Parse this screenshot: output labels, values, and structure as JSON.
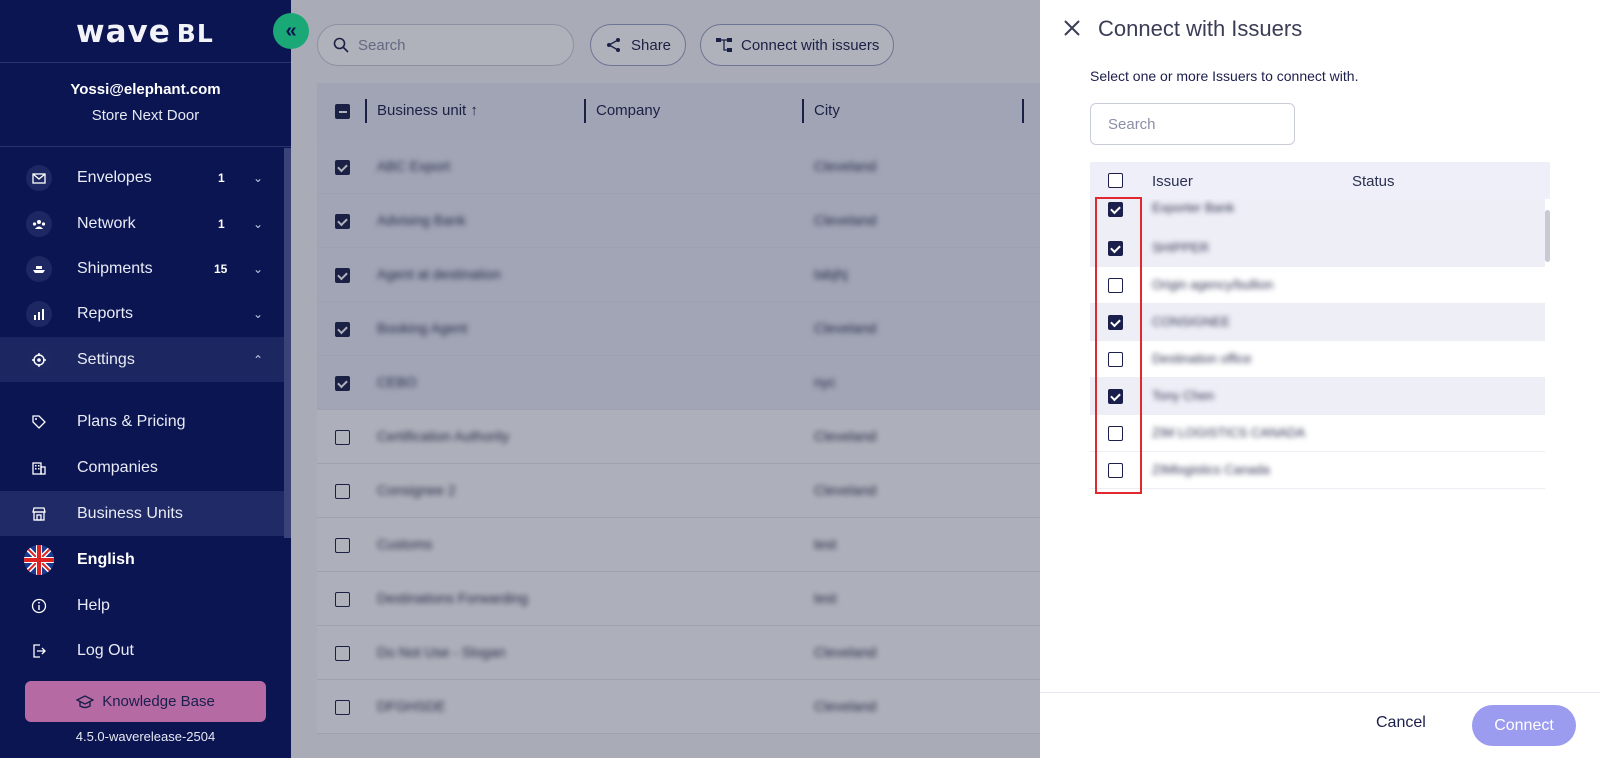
{
  "sidebar": {
    "logo": "wave",
    "logo_suffix": "BL",
    "user_email": "Yossi@elephant.com",
    "user_org": "Store Next Door",
    "nav": [
      {
        "label": "Envelopes",
        "count": "1",
        "icon": "mail-icon"
      },
      {
        "label": "Network",
        "count": "1",
        "icon": "network-icon"
      },
      {
        "label": "Shipments",
        "count": "15",
        "icon": "ship-icon"
      },
      {
        "label": "Reports",
        "count": "",
        "icon": "chart-icon"
      },
      {
        "label": "Settings",
        "count": "",
        "icon": "gear-icon"
      }
    ],
    "sub": [
      {
        "label": "Plans & Pricing",
        "icon": "tag-icon"
      },
      {
        "label": "Companies",
        "icon": "building-icon"
      },
      {
        "label": "Business Units",
        "icon": "store-icon"
      }
    ],
    "language": "English",
    "help": "Help",
    "logout": "Log Out",
    "knowledge_base": "Knowledge Base",
    "version": "4.5.0-waverelease-2504"
  },
  "main": {
    "search_placeholder": "Search",
    "share_label": "Share",
    "connect_label": "Connect with issuers",
    "columns": [
      "Business unit",
      "Company",
      "City"
    ],
    "rows": [
      {
        "name": "ABC Export",
        "city": "Cleveland",
        "checked": true
      },
      {
        "name": "Advising Bank",
        "city": "Cleveland",
        "checked": true
      },
      {
        "name": "Agent at destination",
        "city": "tabjhj",
        "checked": true
      },
      {
        "name": "Booking Agent",
        "city": "Cleveland",
        "checked": true
      },
      {
        "name": "CEBO",
        "city": "nyc",
        "checked": true
      },
      {
        "name": "Certification Authority",
        "city": "Cleveland",
        "checked": false
      },
      {
        "name": "Consignee 2",
        "city": "Cleveland",
        "checked": false
      },
      {
        "name": "Customs",
        "city": "test",
        "checked": false
      },
      {
        "name": "Destinations Forwarding",
        "city": "test",
        "checked": false
      },
      {
        "name": "Do Not Use - Slogan",
        "city": "Cleveland",
        "checked": false
      },
      {
        "name": "DFGHSDE",
        "city": "Cleveland",
        "checked": false
      }
    ]
  },
  "panel": {
    "title": "Connect with Issuers",
    "subtitle": "Select one or more Issuers to connect with.",
    "search_placeholder": "Search",
    "col_issuer": "Issuer",
    "col_status": "Status",
    "issuers": [
      {
        "name": "Exporter Bank",
        "checked": true
      },
      {
        "name": "SHIPPER",
        "checked": true
      },
      {
        "name": "Origin agency/bullion",
        "checked": false
      },
      {
        "name": "CONSIGNEE",
        "checked": true
      },
      {
        "name": "Destination office",
        "checked": false
      },
      {
        "name": "Tony Chen",
        "checked": true
      },
      {
        "name": "ZIM LOGISTICS CANADA",
        "checked": false
      },
      {
        "name": "ZIMlogistics Canada",
        "checked": false
      }
    ],
    "cancel_label": "Cancel",
    "connect_label": "Connect"
  }
}
